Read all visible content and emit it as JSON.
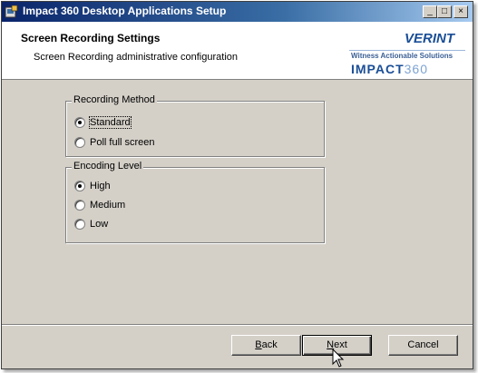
{
  "window": {
    "title": "Impact 360 Desktop Applications Setup",
    "controls": {
      "minimize": "_",
      "maximize": "□",
      "close": "×"
    }
  },
  "header": {
    "title": "Screen Recording Settings",
    "subtitle": "Screen Recording administrative configuration",
    "logo": {
      "brand": "VERINT",
      "slogan": "Witness Actionable Solutions",
      "product_word": "IMPACT",
      "product_number": "360"
    }
  },
  "recording_method": {
    "label": "Recording Method",
    "options": [
      {
        "label": "Standard",
        "selected": true
      },
      {
        "label": "Poll full screen",
        "selected": false
      }
    ]
  },
  "encoding_level": {
    "label": "Encoding Level",
    "options": [
      {
        "label": "High",
        "selected": true
      },
      {
        "label": "Medium",
        "selected": false
      },
      {
        "label": "Low",
        "selected": false
      }
    ]
  },
  "buttons": {
    "back": {
      "mnemonic": "B",
      "rest": "ack"
    },
    "next": {
      "mnemonic": "N",
      "rest": "ext"
    },
    "cancel": "Cancel"
  },
  "icons": {
    "app": "installer-icon",
    "cursor": "mouse-pointer-icon"
  },
  "colors": {
    "title_bar_start": "#0a246a",
    "title_bar_end": "#a6caf0",
    "dialog_face": "#d4d0c8",
    "brand_blue": "#1a4e97"
  }
}
